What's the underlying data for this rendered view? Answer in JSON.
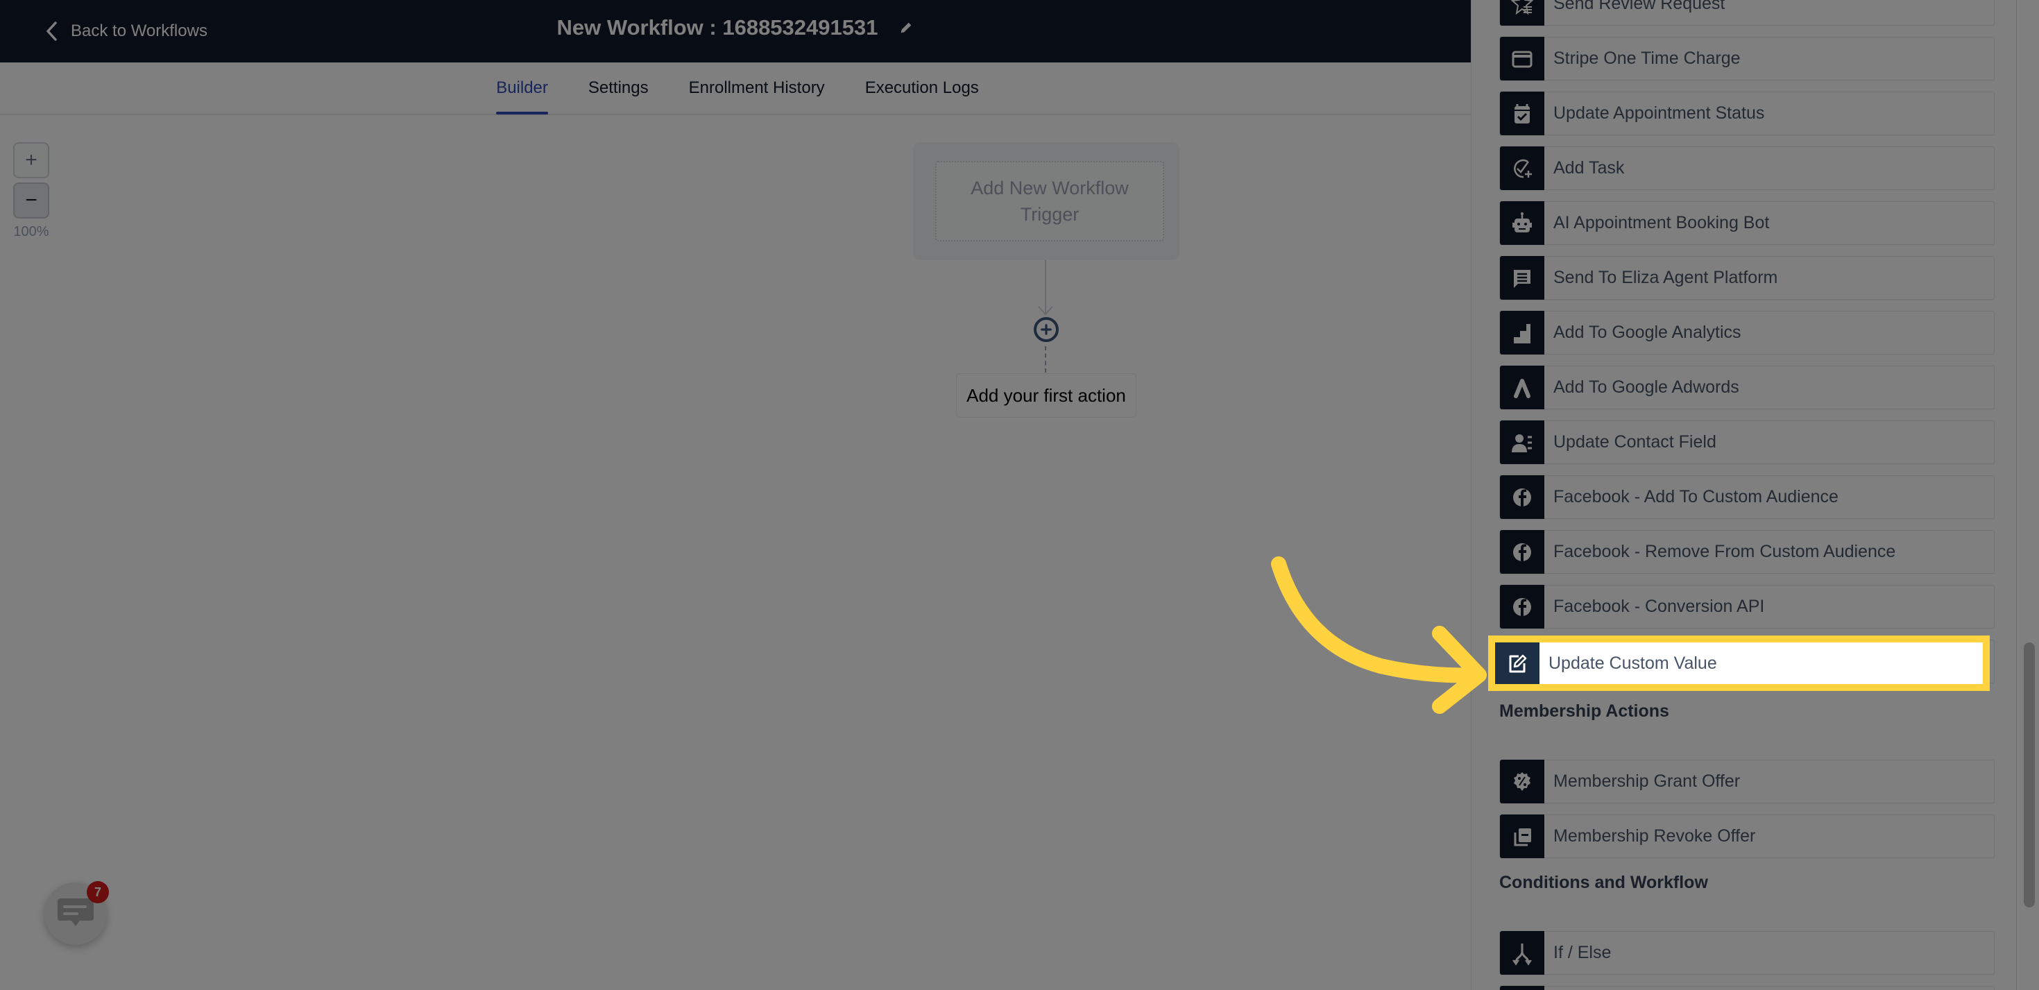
{
  "header": {
    "back_label": "Back to Workflows",
    "title": "New Workflow : 1688532491531"
  },
  "tabs": [
    {
      "label": "Builder",
      "active": true
    },
    {
      "label": "Settings",
      "active": false
    },
    {
      "label": "Enrollment History",
      "active": false
    },
    {
      "label": "Execution Logs",
      "active": false
    }
  ],
  "canvas": {
    "zoom_in": "+",
    "zoom_out": "−",
    "zoom_level": "100%",
    "trigger_placeholder": "Add New Workflow Trigger",
    "first_action_label": "Add your first action"
  },
  "chat": {
    "badge_count": "7"
  },
  "panel": {
    "items_top": [
      {
        "label": "Send Review Request",
        "icon": "star-list-icon"
      },
      {
        "label": "Stripe One Time Charge",
        "icon": "credit-card-icon"
      },
      {
        "label": "Update Appointment Status",
        "icon": "calendar-check-icon"
      },
      {
        "label": "Add Task",
        "icon": "task-add-icon"
      },
      {
        "label": "AI Appointment Booking Bot",
        "icon": "robot-icon"
      },
      {
        "label": "Send To Eliza Agent Platform",
        "icon": "chat-message-icon"
      },
      {
        "label": "Add To Google Analytics",
        "icon": "google-analytics-icon"
      },
      {
        "label": "Add To Google Adwords",
        "icon": "google-ads-icon"
      },
      {
        "label": "Update Contact Field",
        "icon": "contact-field-icon"
      },
      {
        "label": "Facebook - Add To Custom Audience",
        "icon": "facebook-icon"
      },
      {
        "label": "Facebook - Remove From Custom Audience",
        "icon": "facebook-icon"
      },
      {
        "label": "Facebook - Conversion API",
        "icon": "facebook-icon"
      },
      {
        "label": "Update Custom Value",
        "icon": "edit-square-icon",
        "highlighted": true
      }
    ],
    "sections": [
      {
        "title": "Membership Actions",
        "items": [
          {
            "label": "Membership Grant Offer",
            "icon": "discount-badge-icon"
          },
          {
            "label": "Membership Revoke Offer",
            "icon": "stack-minus-icon"
          }
        ]
      },
      {
        "title": "Conditions and Workflow",
        "items": [
          {
            "label": "If / Else",
            "icon": "split-branch-icon"
          }
        ]
      }
    ]
  },
  "colors": {
    "topbar": "#101828",
    "accent": "#2e4bb5",
    "highlight": "#ffd23f",
    "icon_tile": "#101828",
    "badge": "#d41b1b"
  }
}
